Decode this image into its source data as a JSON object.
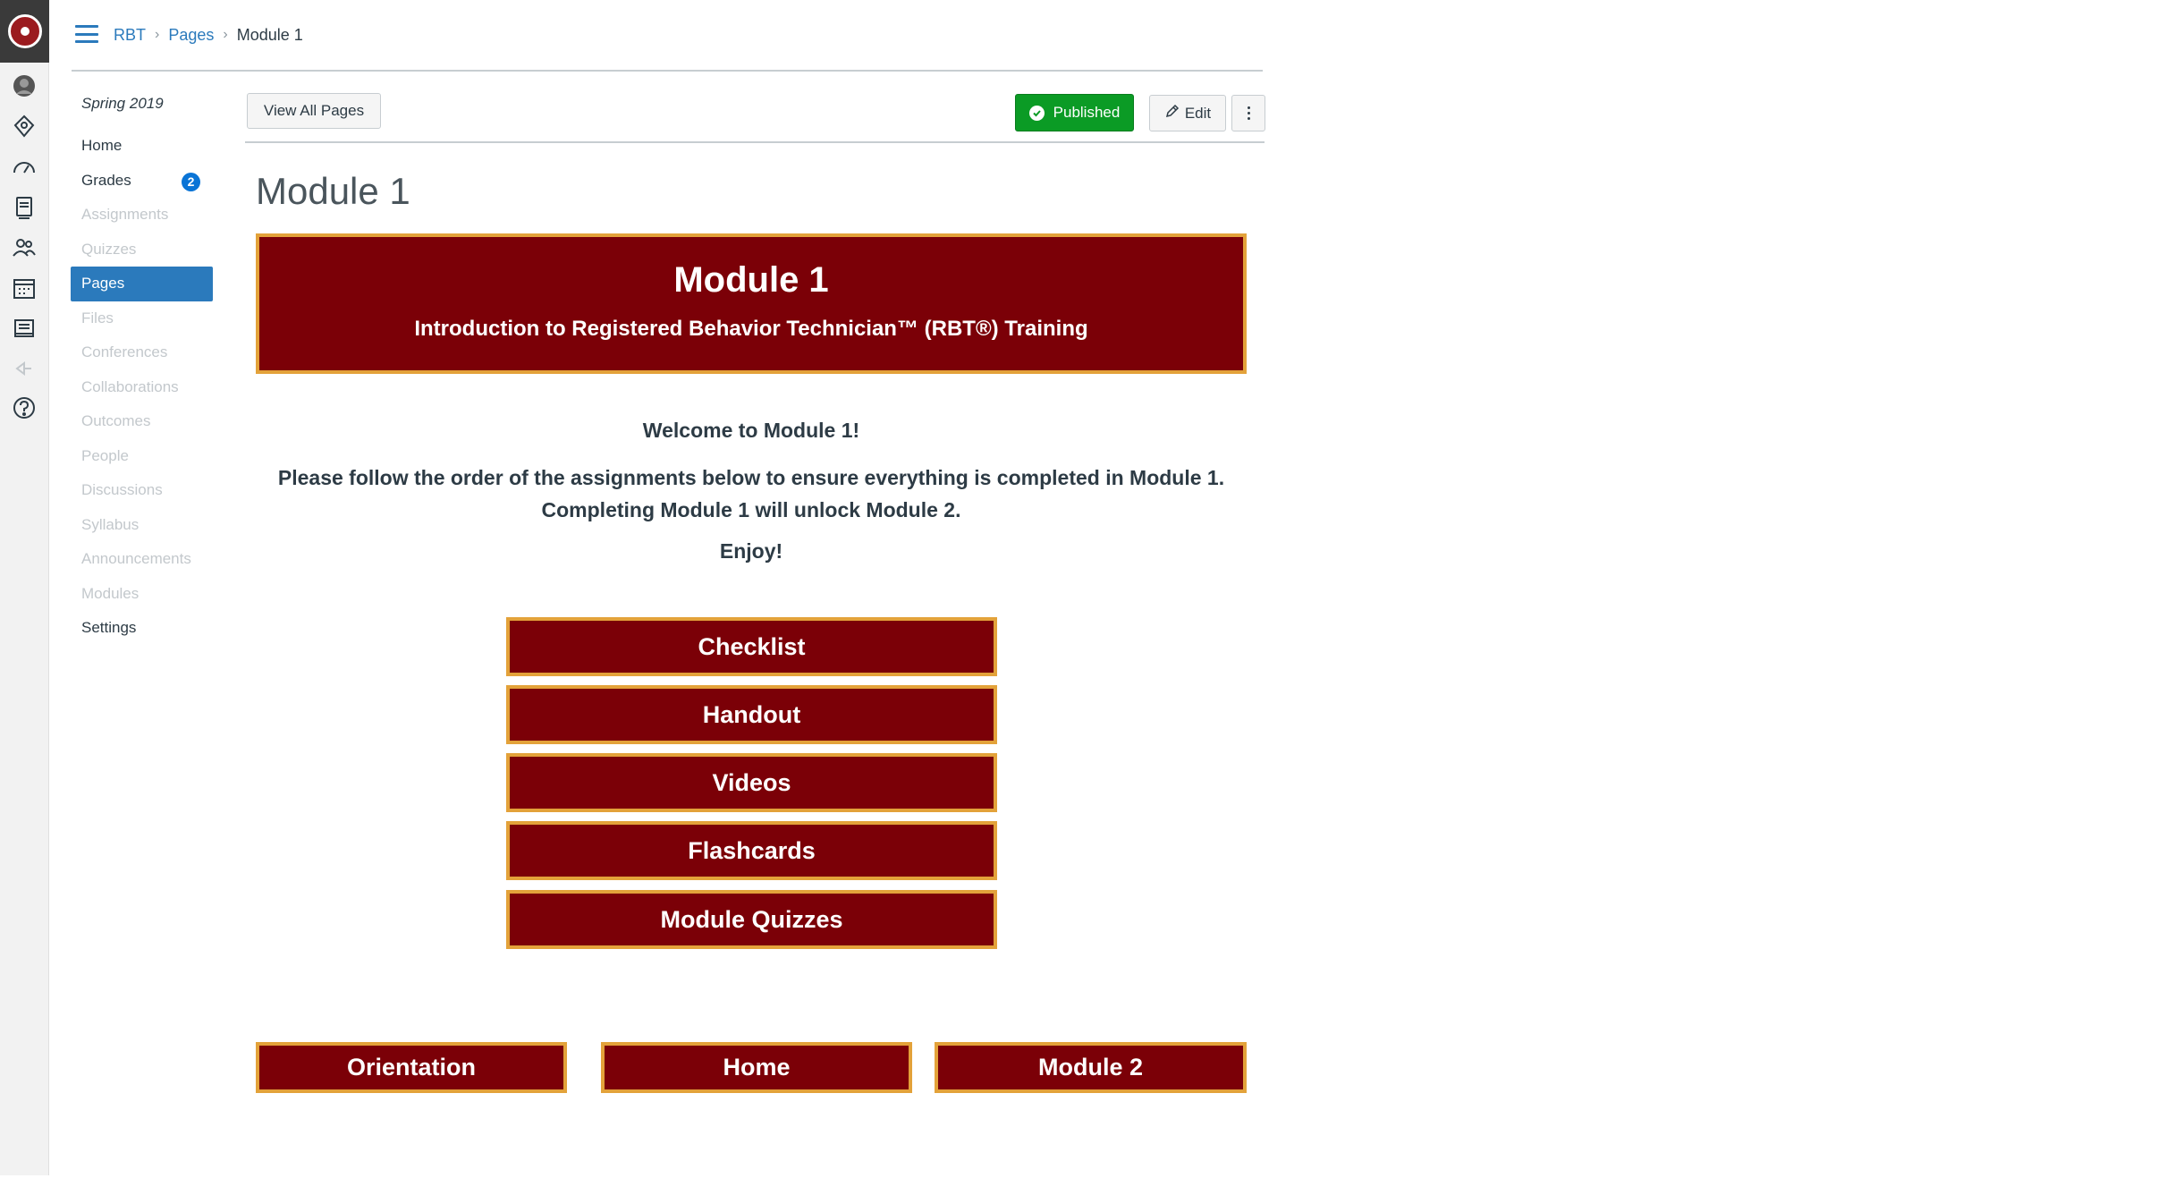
{
  "breadcrumb": {
    "items": [
      "RBT",
      "Pages"
    ],
    "current": "Module 1"
  },
  "course_nav": {
    "term": "Spring 2019",
    "items": [
      {
        "label": "Home",
        "state": "enabled"
      },
      {
        "label": "Grades",
        "state": "enabled",
        "badge": "2"
      },
      {
        "label": "Assignments",
        "state": "disabled"
      },
      {
        "label": "Quizzes",
        "state": "disabled"
      },
      {
        "label": "Pages",
        "state": "active"
      },
      {
        "label": "Files",
        "state": "disabled"
      },
      {
        "label": "Conferences",
        "state": "disabled"
      },
      {
        "label": "Collaborations",
        "state": "disabled"
      },
      {
        "label": "Outcomes",
        "state": "disabled"
      },
      {
        "label": "People",
        "state": "disabled"
      },
      {
        "label": "Discussions",
        "state": "disabled"
      },
      {
        "label": "Syllabus",
        "state": "disabled"
      },
      {
        "label": "Announcements",
        "state": "disabled"
      },
      {
        "label": "Modules",
        "state": "disabled"
      },
      {
        "label": "Settings",
        "state": "enabled"
      }
    ]
  },
  "toolbar": {
    "view_all_label": "View All Pages",
    "published_label": "Published",
    "edit_label": "Edit"
  },
  "page": {
    "title": "Module 1",
    "banner_title": "Module 1",
    "banner_subtitle": "Introduction to Registered Behavior Technician™ (RBT®) Training",
    "welcome": "Welcome to Module 1!",
    "instruction_line1": "Please follow the order of the assignments below to ensure everything is completed in Module 1.",
    "instruction_line2": "Completing Module 1 will unlock Module 2.",
    "enjoy": "Enjoy!",
    "module_buttons": [
      "Checklist",
      "Handout",
      "Videos",
      "Flashcards",
      "Module Quizzes"
    ],
    "footer_buttons": [
      "Orientation",
      "Home",
      "Module 2"
    ]
  },
  "global_nav_icons": [
    "institution-logo-icon",
    "account-avatar-icon",
    "admin-icon",
    "dashboard-icon",
    "courses-icon",
    "groups-icon",
    "calendar-icon",
    "inbox-icon",
    "history-icon",
    "help-icon",
    "collapse-nav-icon"
  ],
  "colors": {
    "brand_maroon": "#7b0007",
    "gold_border": "#e3a23a",
    "link_blue": "#2b7abc",
    "published_green": "#0b9b25"
  }
}
